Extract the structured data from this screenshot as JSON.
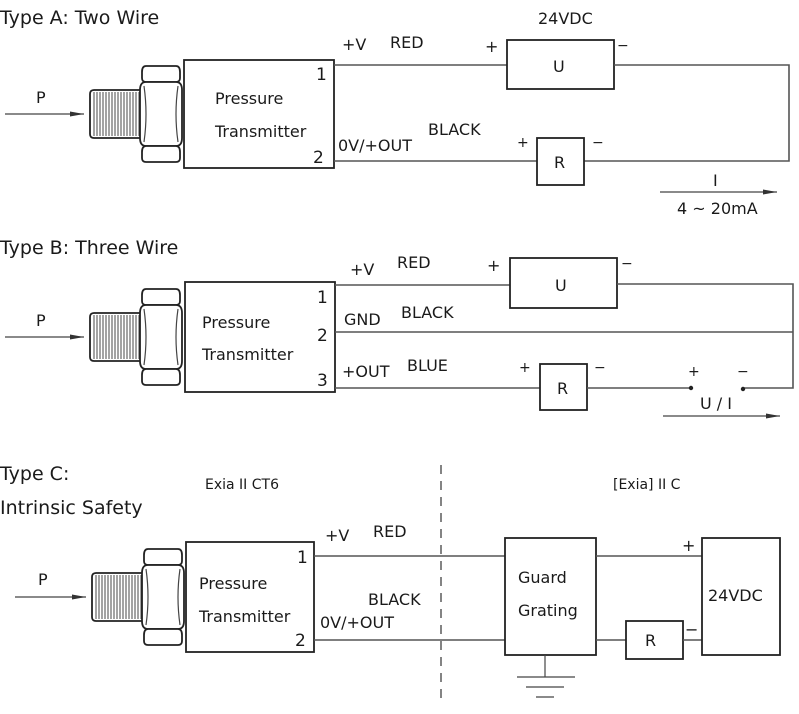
{
  "type_a": {
    "title": "Type A: Two Wire",
    "input_label": "P",
    "transmitter_line1": "Pressure",
    "transmitter_line2": "Transmitter",
    "pin1": "1",
    "pin2": "2",
    "wire1_signal": "+V",
    "wire1_color": "RED",
    "wire2_signal": "0V/+OUT",
    "wire2_color": "BLACK",
    "supply_label": "24VDC",
    "supply_box": "U",
    "supply_plus": "+",
    "supply_minus": "−",
    "resistor_box": "R",
    "resistor_plus": "+",
    "resistor_minus": "−",
    "current_label": "I",
    "current_range": "4 ~ 20mA"
  },
  "type_b": {
    "title": "Type B: Three Wire",
    "input_label": "P",
    "transmitter_line1": "Pressure",
    "transmitter_line2": "Transmitter",
    "pin1": "1",
    "pin2": "2",
    "pin3": "3",
    "wire1_signal": "+V",
    "wire1_color": "RED",
    "wire2_signal": "GND",
    "wire2_color": "BLACK",
    "wire3_signal": "+OUT",
    "wire3_color": "BLUE",
    "supply_box": "U",
    "supply_plus": "+",
    "supply_minus": "−",
    "resistor_box": "R",
    "resistor_plus": "+",
    "resistor_minus": "−",
    "output_plus": "+",
    "output_minus": "−",
    "output_label": "U / I"
  },
  "type_c": {
    "title_line1": "Type C:",
    "title_line2": "Intrinsic Safety",
    "hazard_zone": "Exia II CT6",
    "safe_zone": "[Exia] II C",
    "input_label": "P",
    "transmitter_line1": "Pressure",
    "transmitter_line2": "Transmitter",
    "pin1": "1",
    "pin2": "2",
    "wire1_signal": "+V",
    "wire1_color": "RED",
    "wire2_signal": "0V/+OUT",
    "wire2_color": "BLACK",
    "barrier_line1": "Guard",
    "barrier_line2": "Grating",
    "resistor_box": "R",
    "supply_box": "24VDC",
    "supply_plus": "+",
    "supply_minus": "−"
  }
}
